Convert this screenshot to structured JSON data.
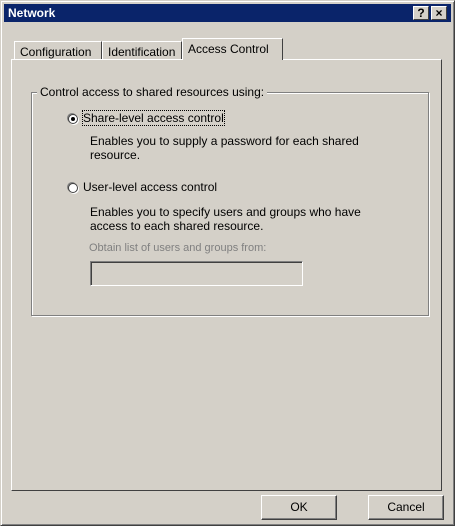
{
  "window": {
    "title": "Network",
    "help_glyph": "?",
    "close_glyph": "×"
  },
  "tabs": [
    {
      "label": "Configuration",
      "active": false
    },
    {
      "label": "Identification",
      "active": false
    },
    {
      "label": "Access Control",
      "active": true
    }
  ],
  "group": {
    "label": "Control access to shared resources using:",
    "options": [
      {
        "label": "Share-level access control",
        "selected": true,
        "description": "Enables you to supply a password for each shared resource."
      },
      {
        "label": "User-level access control",
        "selected": false,
        "description": "Enables you to specify users and groups who have access to each shared resource."
      }
    ],
    "obtain_label": "Obtain list of users and groups from:",
    "obtain_value": ""
  },
  "buttons": {
    "ok": "OK",
    "cancel": "Cancel"
  },
  "colors": {
    "titlebar": "#0a246a",
    "face": "#d4d0c8"
  }
}
